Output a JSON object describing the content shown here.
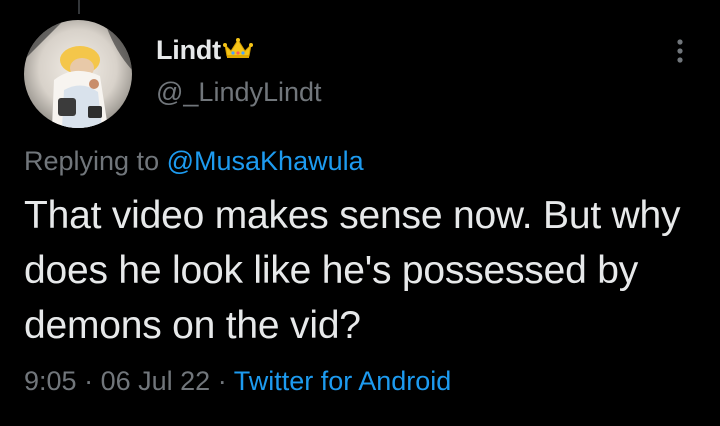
{
  "tweet": {
    "author": {
      "display_name": "Lindt",
      "badge_icon": "crown-emoji-icon",
      "handle": "@_LindyLindt"
    },
    "reply": {
      "prefix": "Replying to",
      "mention": "@MusaKhawula"
    },
    "text": "That video makes sense now. But why does he look like he's possessed by demons on the vid?",
    "time": "9:05",
    "separator": "·",
    "date": "06 Jul 22",
    "source": "Twitter for Android"
  },
  "icons": {
    "more": "more-vertical-icon"
  },
  "colors": {
    "background": "#000000",
    "primary_text": "#e7e9ea",
    "secondary_text": "#71767b",
    "link": "#1d9bf0",
    "crown": "#f5c518"
  }
}
